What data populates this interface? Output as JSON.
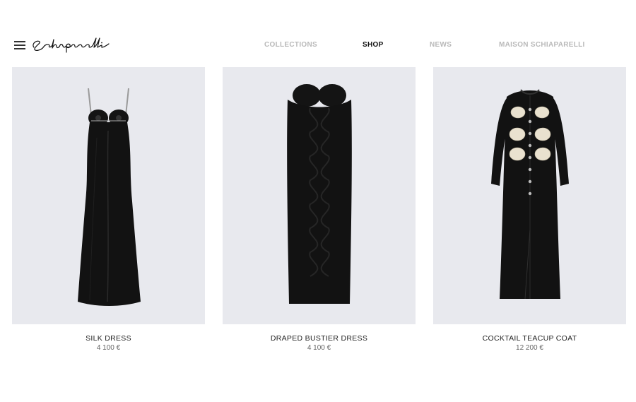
{
  "header": {
    "menu_icon": "hamburger-menu-icon",
    "logo_text": "Schiaparelli",
    "nav": [
      {
        "label": "COLLECTIONS",
        "active": false
      },
      {
        "label": "SHOP",
        "active": true
      },
      {
        "label": "NEWS",
        "active": false
      },
      {
        "label": "MAISON SCHIAPARELLI",
        "active": false
      }
    ]
  },
  "colors": {
    "photo_background": "#e8e9ee",
    "nav_inactive": "#b9b9b9",
    "nav_active": "#111111"
  },
  "products": [
    {
      "name": "SILK DRESS",
      "price": "4 100 €"
    },
    {
      "name": "DRAPED BUSTIER DRESS",
      "price": "4 100 €"
    },
    {
      "name": "COCKTAIL TEACUP COAT",
      "price": "12 200 €"
    }
  ]
}
